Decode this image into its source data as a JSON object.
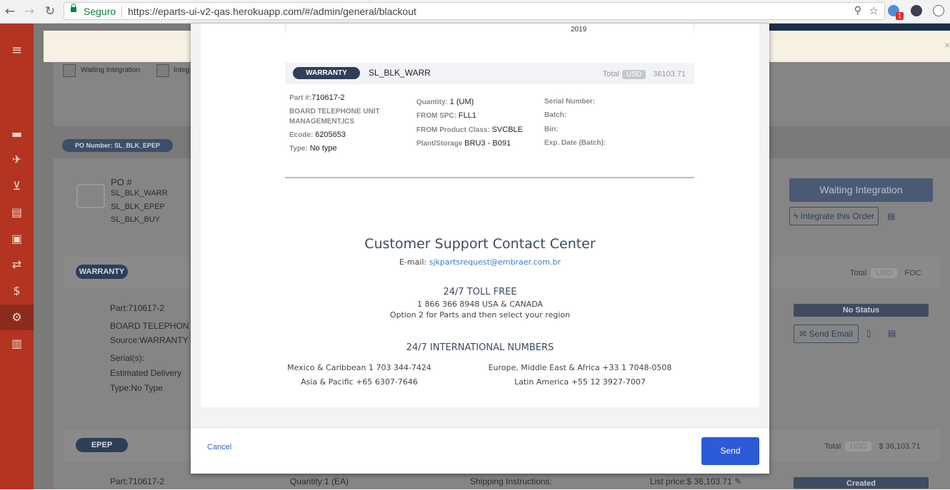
{
  "browser": {
    "secure_label": "Seguro",
    "url": "https://eparts-ui-v2-qas.herokuapp.com/#/admin/general/blackout",
    "ext_badge": "1"
  },
  "background": {
    "filters": [
      "Waiting Integration",
      "Integ"
    ],
    "po_number_pill": "PO Number: SL_BLK_EPEP",
    "po_label": "PO #",
    "po_numbers": [
      "SL_BLK_WARR",
      "SL_BLK_EPEP",
      "SL_BLK_BUY"
    ],
    "waiting_integration": "Waiting Integration",
    "integrate_button": "Integrate this Order",
    "warranty_badge": "WARRANTY",
    "total_label": "Total",
    "usd": "USD",
    "foc": "FOC",
    "part": "Part:",
    "part_value": "710617-2",
    "board": "BOARD TELEPHON",
    "source": "Source:",
    "source_value": "WARRANTY",
    "serials": "Serial(s):",
    "estimated_delivery": "Estimated Delivery",
    "type": "Type:",
    "type_value": "No Type",
    "no_status": "No Status",
    "send_email": "Send Email",
    "epep_badge": "EPEP",
    "total2": "$ 36,103.71",
    "bottom": {
      "part": "Part:",
      "part_value": "710617-2",
      "quantity": "Quantity:",
      "quantity_value": "1 (EA)",
      "shipping": "Shipping Instructions:",
      "list_price": "List price:",
      "list_price_value": "$ 36,103.71",
      "created": "Created"
    }
  },
  "modal": {
    "year": "2019",
    "warranty_pill": "WARRANTY",
    "order_name": "SL_BLK_WARR",
    "total_label": "Total",
    "currency": "USD",
    "total_value": "36103.71",
    "details": {
      "part_label": "Part #:",
      "part_value": "710617-2",
      "description": "BOARD TELEPHONE UNIT MANAGEMENT,ICS",
      "ecode_label": "Ecode:",
      "ecode_value": "6205653",
      "type_label": "Type:",
      "type_value": "No type",
      "quantity_label": "Quantity:",
      "quantity_value": "1 (UM)",
      "from_spc_label": "FROM SPC:",
      "from_spc_value": "FLL1",
      "from_class_label": "FROM Product Class:",
      "from_class_value": "SVCBLE",
      "plant_label": "Plant/Storage",
      "plant_value": "BRU3 - B091",
      "serial_label": "Serial Number:",
      "batch_label": "Batch:",
      "bin_label": "Bin:",
      "exp_label": "Exp. Date (Batch):"
    },
    "support": {
      "title": "Customer Support Contact Center",
      "email_label": "E-mail:",
      "email": "sjkpartsrequest@embraer.com.br",
      "toll_title": "24/7 TOLL FREE",
      "toll_number": "1 866 366 8948 USA & CANADA",
      "toll_option": "Option 2 for Parts and then select your region",
      "intl_title": "24/7 INTERNATIONAL NUMBERS",
      "mexico": "Mexico & Caribbean 1 703 344-7424",
      "europe": "Europe, Middle East & Africa +33 1 7048-0508",
      "asia": "Asia & Pacific +65 6307-7646",
      "latin": "Latin America +55 12 3927-7007"
    },
    "cancel": "Cancel",
    "send": "Send"
  }
}
